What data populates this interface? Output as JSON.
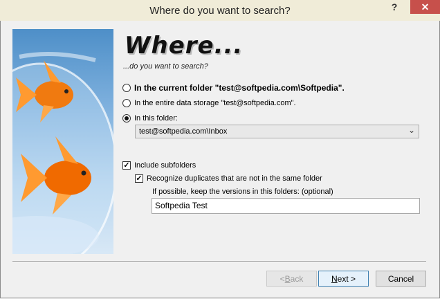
{
  "window": {
    "title": "Where do you want to search?",
    "help_label": "?",
    "close_label": "✕"
  },
  "header": {
    "heading": "Where...",
    "subheading": "...do you want to search?"
  },
  "options": {
    "current_folder": "In the current folder \"test@softpedia.com\\Softpedia\".",
    "entire_storage": "In the entire data storage \"test@softpedia.com\".",
    "this_folder": "In this folder:",
    "selected": "this_folder"
  },
  "folder_select": {
    "value": "test@softpedia.com\\Inbox"
  },
  "checks": {
    "include_subfolders": {
      "label": "Include subfolders",
      "checked": true
    },
    "recognize_duplicates": {
      "label": "Recognize duplicates that are not in the same folder",
      "checked": true
    }
  },
  "versions": {
    "label": "If possible, keep the versions in this folders: (optional)",
    "value": "Softpedia Test"
  },
  "buttons": {
    "back_prefix": "< ",
    "back_key": "B",
    "back_rest": "ack",
    "next_key": "N",
    "next_rest": "ext >",
    "cancel": "Cancel"
  },
  "colors": {
    "titlebar": "#f0ecd8",
    "close_button": "#c7504b",
    "fish": "#f07a10"
  },
  "icons": [
    "goldfish-bowl-image",
    "chevron-down-icon",
    "checkmark-icon"
  ]
}
